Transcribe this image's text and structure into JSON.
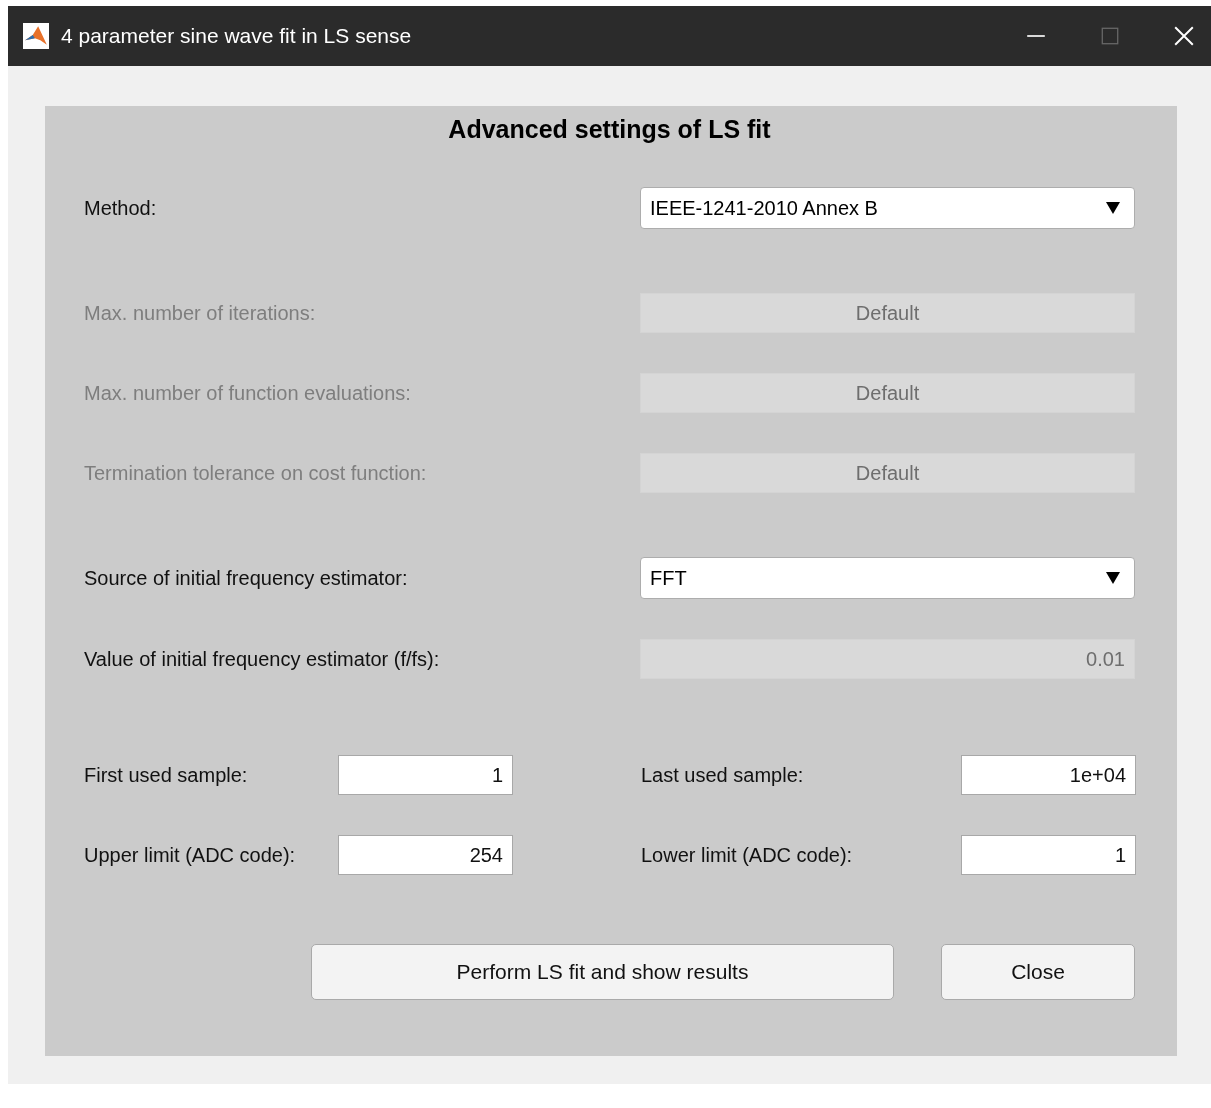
{
  "window": {
    "title": "4 parameter sine wave fit in LS sense",
    "maximize_enabled": false
  },
  "panel": {
    "title": "Advanced settings of LS fit",
    "sections": [
      {
        "rows": [
          {
            "label": "Method:",
            "label_disabled": false,
            "kind": "dropdown",
            "value": "IEEE-1241-2010 Annex B",
            "disabled": false
          }
        ]
      },
      {
        "rows": [
          {
            "label": "Max. number of iterations:",
            "label_disabled": true,
            "kind": "field",
            "value": "Default",
            "disabled": true
          },
          {
            "label": "Max. number of function evaluations:",
            "label_disabled": true,
            "kind": "field",
            "value": "Default",
            "disabled": true
          },
          {
            "label": "Termination tolerance on cost function:",
            "label_disabled": true,
            "kind": "field",
            "value": "Default",
            "disabled": true
          }
        ]
      },
      {
        "rows": [
          {
            "label": "Source of initial frequency estimator:",
            "label_disabled": false,
            "kind": "dropdown",
            "value": "FFT",
            "disabled": false
          },
          {
            "label": "Value of initial frequency estimator (f/fs):",
            "label_disabled": false,
            "kind": "number",
            "value": "0.01",
            "disabled": true
          }
        ]
      }
    ],
    "limits": [
      {
        "label": "First used sample:",
        "value": "1"
      },
      {
        "label": "Last used sample:",
        "value": "1e+04"
      },
      {
        "label": "Upper limit (ADC code):",
        "value": "254"
      },
      {
        "label": "Lower limit (ADC code):",
        "value": "1"
      }
    ],
    "buttons": [
      {
        "label": "Perform LS fit and show results",
        "kind": "primary"
      },
      {
        "label": "Close",
        "kind": "secondary"
      }
    ]
  }
}
